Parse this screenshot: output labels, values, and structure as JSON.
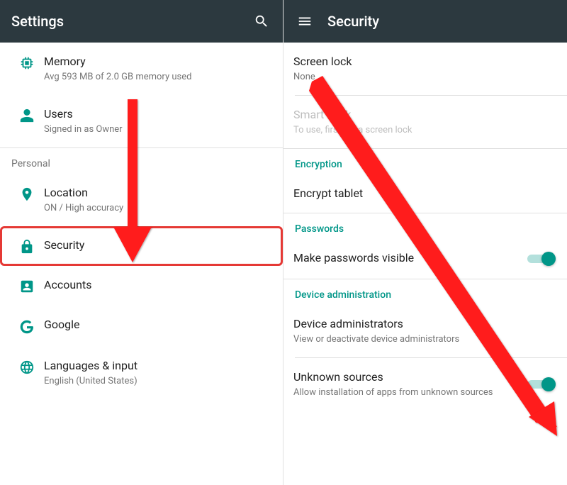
{
  "left": {
    "title": "Settings",
    "items": [
      {
        "title": "Memory",
        "sub": "Avg 593 MB of 2.0 GB memory used"
      },
      {
        "title": "Users",
        "sub": "Signed in as Owner"
      }
    ],
    "section": "Personal",
    "personal": [
      {
        "title": "Location",
        "sub": "ON / High accuracy"
      },
      {
        "title": "Security"
      },
      {
        "title": "Accounts"
      },
      {
        "title": "Google"
      },
      {
        "title": "Languages & input",
        "sub": "English (United States)"
      }
    ]
  },
  "right": {
    "title": "Security",
    "screenlock": {
      "title": "Screen lock",
      "sub": "None"
    },
    "smartlock": {
      "title": "Smart Lock",
      "sub": "To use, first set a screen lock"
    },
    "enc_hdr": "Encryption",
    "enc": {
      "title": "Encrypt tablet"
    },
    "pwd_hdr": "Passwords",
    "pwd": {
      "title": "Make passwords visible"
    },
    "admin_hdr": "Device administration",
    "admin": {
      "title": "Device administrators",
      "sub": "View or deactivate device administrators"
    },
    "unknown": {
      "title": "Unknown sources",
      "sub": "Allow installation of apps from unknown sources"
    }
  }
}
